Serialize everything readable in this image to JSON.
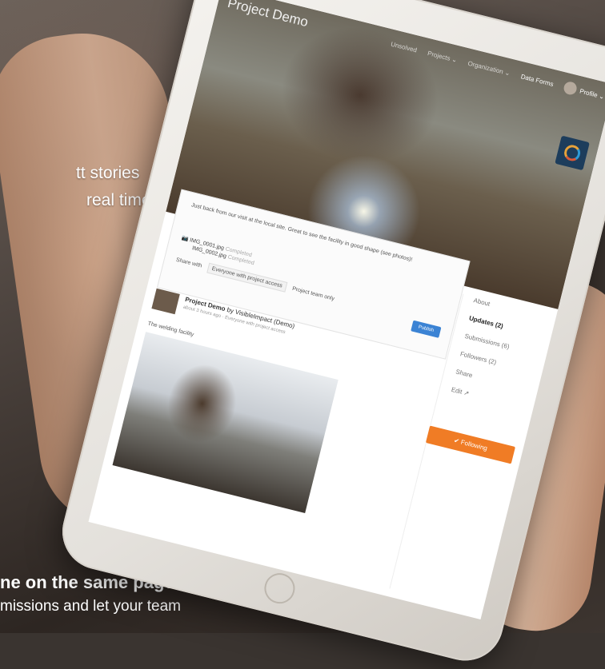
{
  "overlay": {
    "line1": "tt stories",
    "line2": "real time",
    "tagline": "ne on the same page.",
    "subline": "missions and let your team"
  },
  "app": {
    "project_title": "Project Demo",
    "nav": [
      "Unsolved",
      "Projects ⌄",
      "Organization ⌄",
      "Data Forms"
    ],
    "profile": "Profile ⌄"
  },
  "composer": {
    "text": "Just back from our visit at the local site. Great to see the facility in good shape (see photos)!",
    "files": [
      {
        "name": "IMG_0001.jpg",
        "status": "Completed"
      },
      {
        "name": "IMG_0002.jpg",
        "status": "Completed"
      }
    ],
    "share_label": "Share with",
    "share_option_1": "Everyone with project access",
    "share_option_2": "Project team only",
    "publish": "Publish"
  },
  "update": {
    "author": "Project Demo",
    "by": "by VisibleImpact (Demo)",
    "meta": "about 3 hours ago · Everyone with project access",
    "body": "The welding facility"
  },
  "sidebar": {
    "items": [
      "About",
      "Updates (2)",
      "Submissions (6)",
      "Followers (2)",
      "Share",
      "Edit ↗"
    ],
    "following": "✔  Following"
  }
}
